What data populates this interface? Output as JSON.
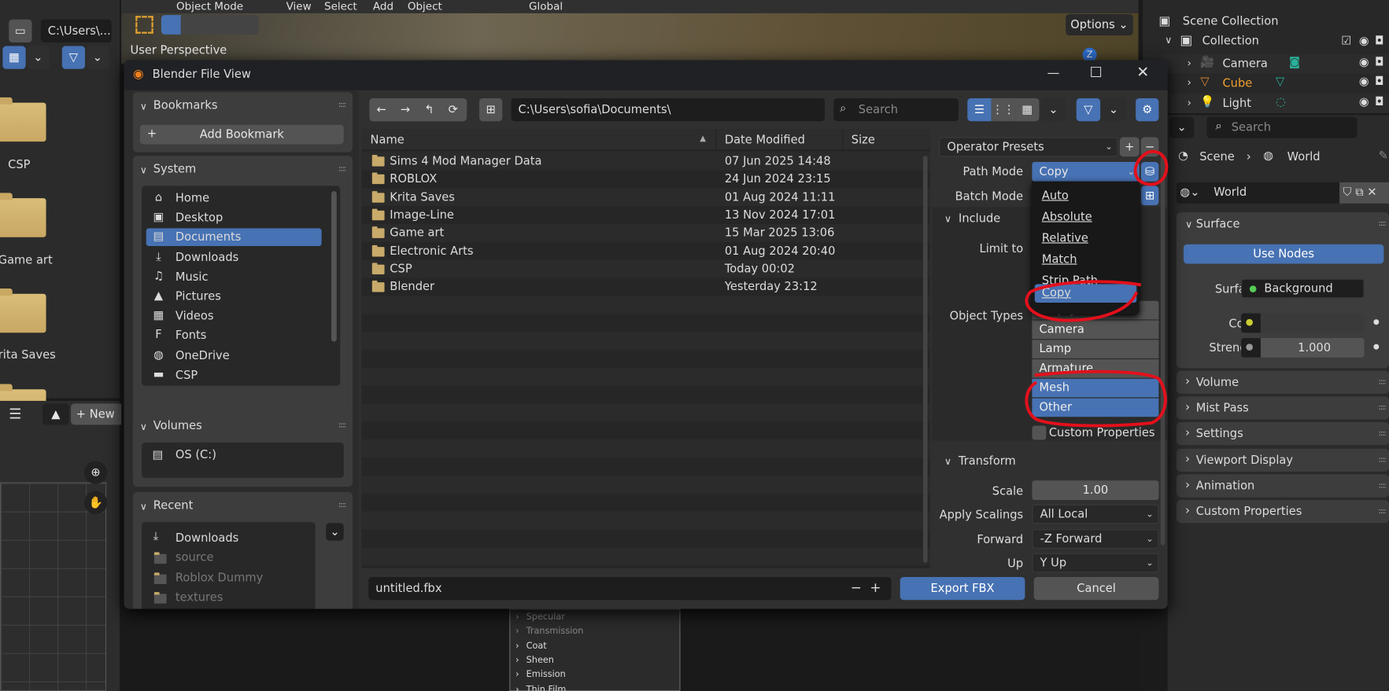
{
  "left_browser": {
    "path": "C:\\Users\\...",
    "folders": [
      "CSP",
      "Game art",
      "rita Saves"
    ]
  },
  "image_editor": {
    "new_label": "New"
  },
  "viewport": {
    "menus": [
      "Object Mode",
      "View",
      "Select",
      "Add",
      "Object"
    ],
    "transform_orientation": "Global",
    "perspective_label": "User Perspective",
    "options_label": "Options",
    "gizmo_axis": "Z"
  },
  "node_panel": {
    "items": [
      "Specular",
      "Transmission",
      "Coat",
      "Sheen",
      "Emission",
      "Thin Film"
    ]
  },
  "dialog": {
    "title": "Blender File View",
    "sidebar": {
      "bookmarks": {
        "title": "Bookmarks",
        "add_label": "Add Bookmark"
      },
      "system": {
        "title": "System",
        "items": [
          {
            "label": "Home",
            "icon": "⌂"
          },
          {
            "label": "Desktop",
            "icon": "▣"
          },
          {
            "label": "Documents",
            "icon": "▤"
          },
          {
            "label": "Downloads",
            "icon": "⤓"
          },
          {
            "label": "Music",
            "icon": "♫"
          },
          {
            "label": "Pictures",
            "icon": "▲"
          },
          {
            "label": "Videos",
            "icon": "▦"
          },
          {
            "label": "Fonts",
            "icon": "F"
          },
          {
            "label": "OneDrive",
            "icon": "◍"
          },
          {
            "label": "CSP",
            "icon": "▬"
          }
        ],
        "selected": "Documents"
      },
      "volumes": {
        "title": "Volumes",
        "items": [
          "OS (C:)"
        ]
      },
      "recent": {
        "title": "Recent",
        "items": [
          "Downloads",
          "source",
          "Roblox Dummy",
          "textures"
        ]
      }
    },
    "toolbar": {
      "path": "C:\\Users\\sofia\\Documents\\",
      "search_placeholder": "Search"
    },
    "columns": {
      "name": "Name",
      "date": "Date Modified",
      "size": "Size"
    },
    "files": [
      {
        "name": "Sims 4 Mod Manager Data",
        "date": "07 Jun 2025 14:48"
      },
      {
        "name": "ROBLOX",
        "date": "24 Jun 2024 23:15"
      },
      {
        "name": "Krita Saves",
        "date": "01 Aug 2024 11:11"
      },
      {
        "name": "Image-Line",
        "date": "13 Nov 2024 17:01"
      },
      {
        "name": "Game art",
        "date": "15 Mar 2025 13:06"
      },
      {
        "name": "Electronic Arts",
        "date": "01 Aug 2024 20:40"
      },
      {
        "name": "CSP",
        "date": "Today 00:02"
      },
      {
        "name": "Blender",
        "date": "Yesterday 23:12"
      }
    ],
    "operator": {
      "presets_label": "Operator Presets",
      "path_mode_label": "Path Mode",
      "path_mode_value": "Copy",
      "batch_mode_label": "Batch Mode",
      "path_mode_options": [
        "Auto",
        "Absolute",
        "Relative",
        "Match",
        "Strip Path",
        "Copy"
      ],
      "path_mode_selected": "Copy",
      "include_label": "Include",
      "limit_to_label": "Limit to",
      "object_types_label": "Object Types",
      "object_types": [
        {
          "label": "Empty",
          "on": false
        },
        {
          "label": "Camera",
          "on": false
        },
        {
          "label": "Lamp",
          "on": false
        },
        {
          "label": "Armature",
          "on": false
        },
        {
          "label": "Mesh",
          "on": true
        },
        {
          "label": "Other",
          "on": true
        }
      ],
      "custom_properties_label": "Custom Properties",
      "transform_label": "Transform",
      "scale_label": "Scale",
      "scale_value": "1.00",
      "apply_scalings_label": "Apply Scalings",
      "apply_scalings_value": "All Local",
      "forward_label": "Forward",
      "forward_value": "-Z Forward",
      "up_label": "Up",
      "up_value": "Y Up"
    },
    "filename": "untitled.fbx",
    "export_label": "Export FBX",
    "cancel_label": "Cancel"
  },
  "outliner": {
    "search_placeholder": "Search",
    "scene_collection": "Scene Collection",
    "collection": "Collection",
    "objects": [
      {
        "name": "Camera",
        "active": false
      },
      {
        "name": "Cube",
        "active": true
      },
      {
        "name": "Light",
        "active": false
      }
    ]
  },
  "properties": {
    "search_placeholder": "Search",
    "breadcrumb": [
      "Scene",
      "World"
    ],
    "world_name": "World",
    "surface_panel": "Surface",
    "use_nodes_label": "Use Nodes",
    "surface_label": "Surface",
    "surface_value": "Background",
    "color_label": "Color",
    "strength_label": "Strength",
    "strength_value": "1.000",
    "panels": [
      "Volume",
      "Mist Pass",
      "Settings",
      "Viewport Display",
      "Animation",
      "Custom Properties"
    ]
  },
  "colors": {
    "accent": "#4772b3",
    "annotation": "#e3101c",
    "active_object": "#f0a030"
  }
}
